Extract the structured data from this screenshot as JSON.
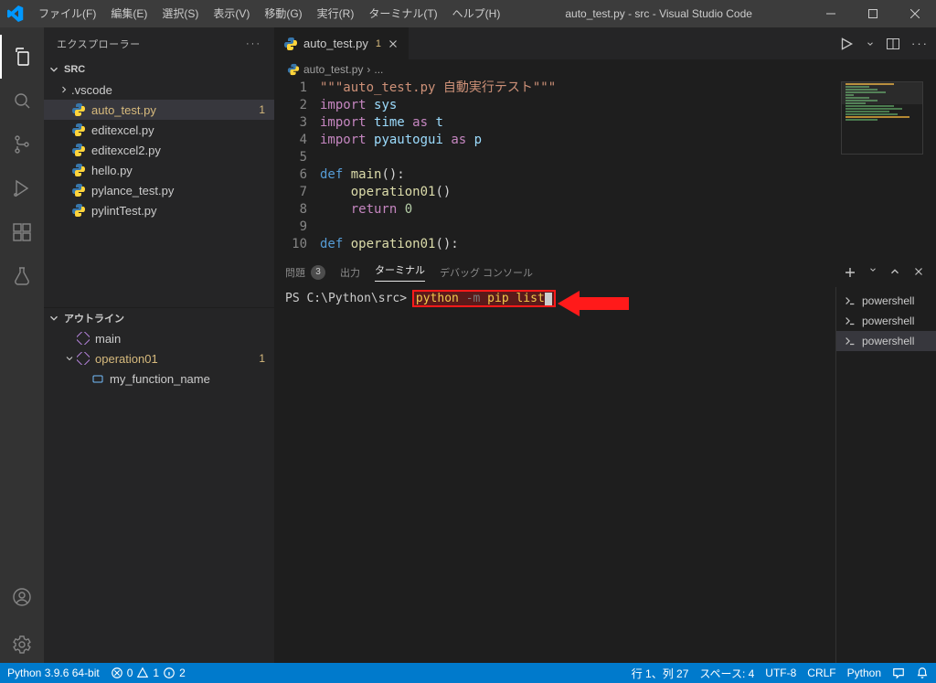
{
  "window": {
    "title": "auto_test.py - src - Visual Studio Code"
  },
  "menu": {
    "file": "ファイル(F)",
    "edit": "編集(E)",
    "selection": "選択(S)",
    "view": "表示(V)",
    "go": "移動(G)",
    "run": "実行(R)",
    "terminal": "ターミナル(T)",
    "help": "ヘルプ(H)"
  },
  "sidebar": {
    "title": "エクスプローラー",
    "project": "SRC",
    "files": [
      {
        "label": ".vscode",
        "folder": true
      },
      {
        "label": "auto_test.py",
        "modified": 1
      },
      {
        "label": "editexcel.py"
      },
      {
        "label": "editexcel2.py"
      },
      {
        "label": "hello.py"
      },
      {
        "label": "pylance_test.py"
      },
      {
        "label": "pylintTest.py"
      }
    ],
    "outline_title": "アウトライン",
    "outline": [
      {
        "label": "main"
      },
      {
        "label": "operation01",
        "badge": 1
      },
      {
        "label": "my_function_name"
      }
    ]
  },
  "tab": {
    "file": "auto_test.py",
    "dirty": "1"
  },
  "breadcrumbs": {
    "file": "auto_test.py",
    "sep": "›",
    "node": "..."
  },
  "code_lines": [
    "1",
    "2",
    "3",
    "4",
    "5",
    "6",
    "7",
    "8",
    "9",
    "10"
  ],
  "panel": {
    "problems": "問題",
    "problems_count": "3",
    "output": "出力",
    "terminal": "ターミナル",
    "debug": "デバッグ コンソール"
  },
  "terminal": {
    "prompt": "PS C:\\Python\\src> ",
    "cmd_a": "python ",
    "cmd_b": "-m",
    "cmd_c": " pip list"
  },
  "term_sessions": [
    "powershell",
    "powershell",
    "powershell"
  ],
  "statusbar": {
    "python": "Python 3.9.6 64-bit",
    "err": "0",
    "warn": "1",
    "info": "2",
    "ln": "行 1、列 27",
    "spaces": "スペース: 4",
    "enc": "UTF-8",
    "eol": "CRLF",
    "lang": "Python"
  }
}
